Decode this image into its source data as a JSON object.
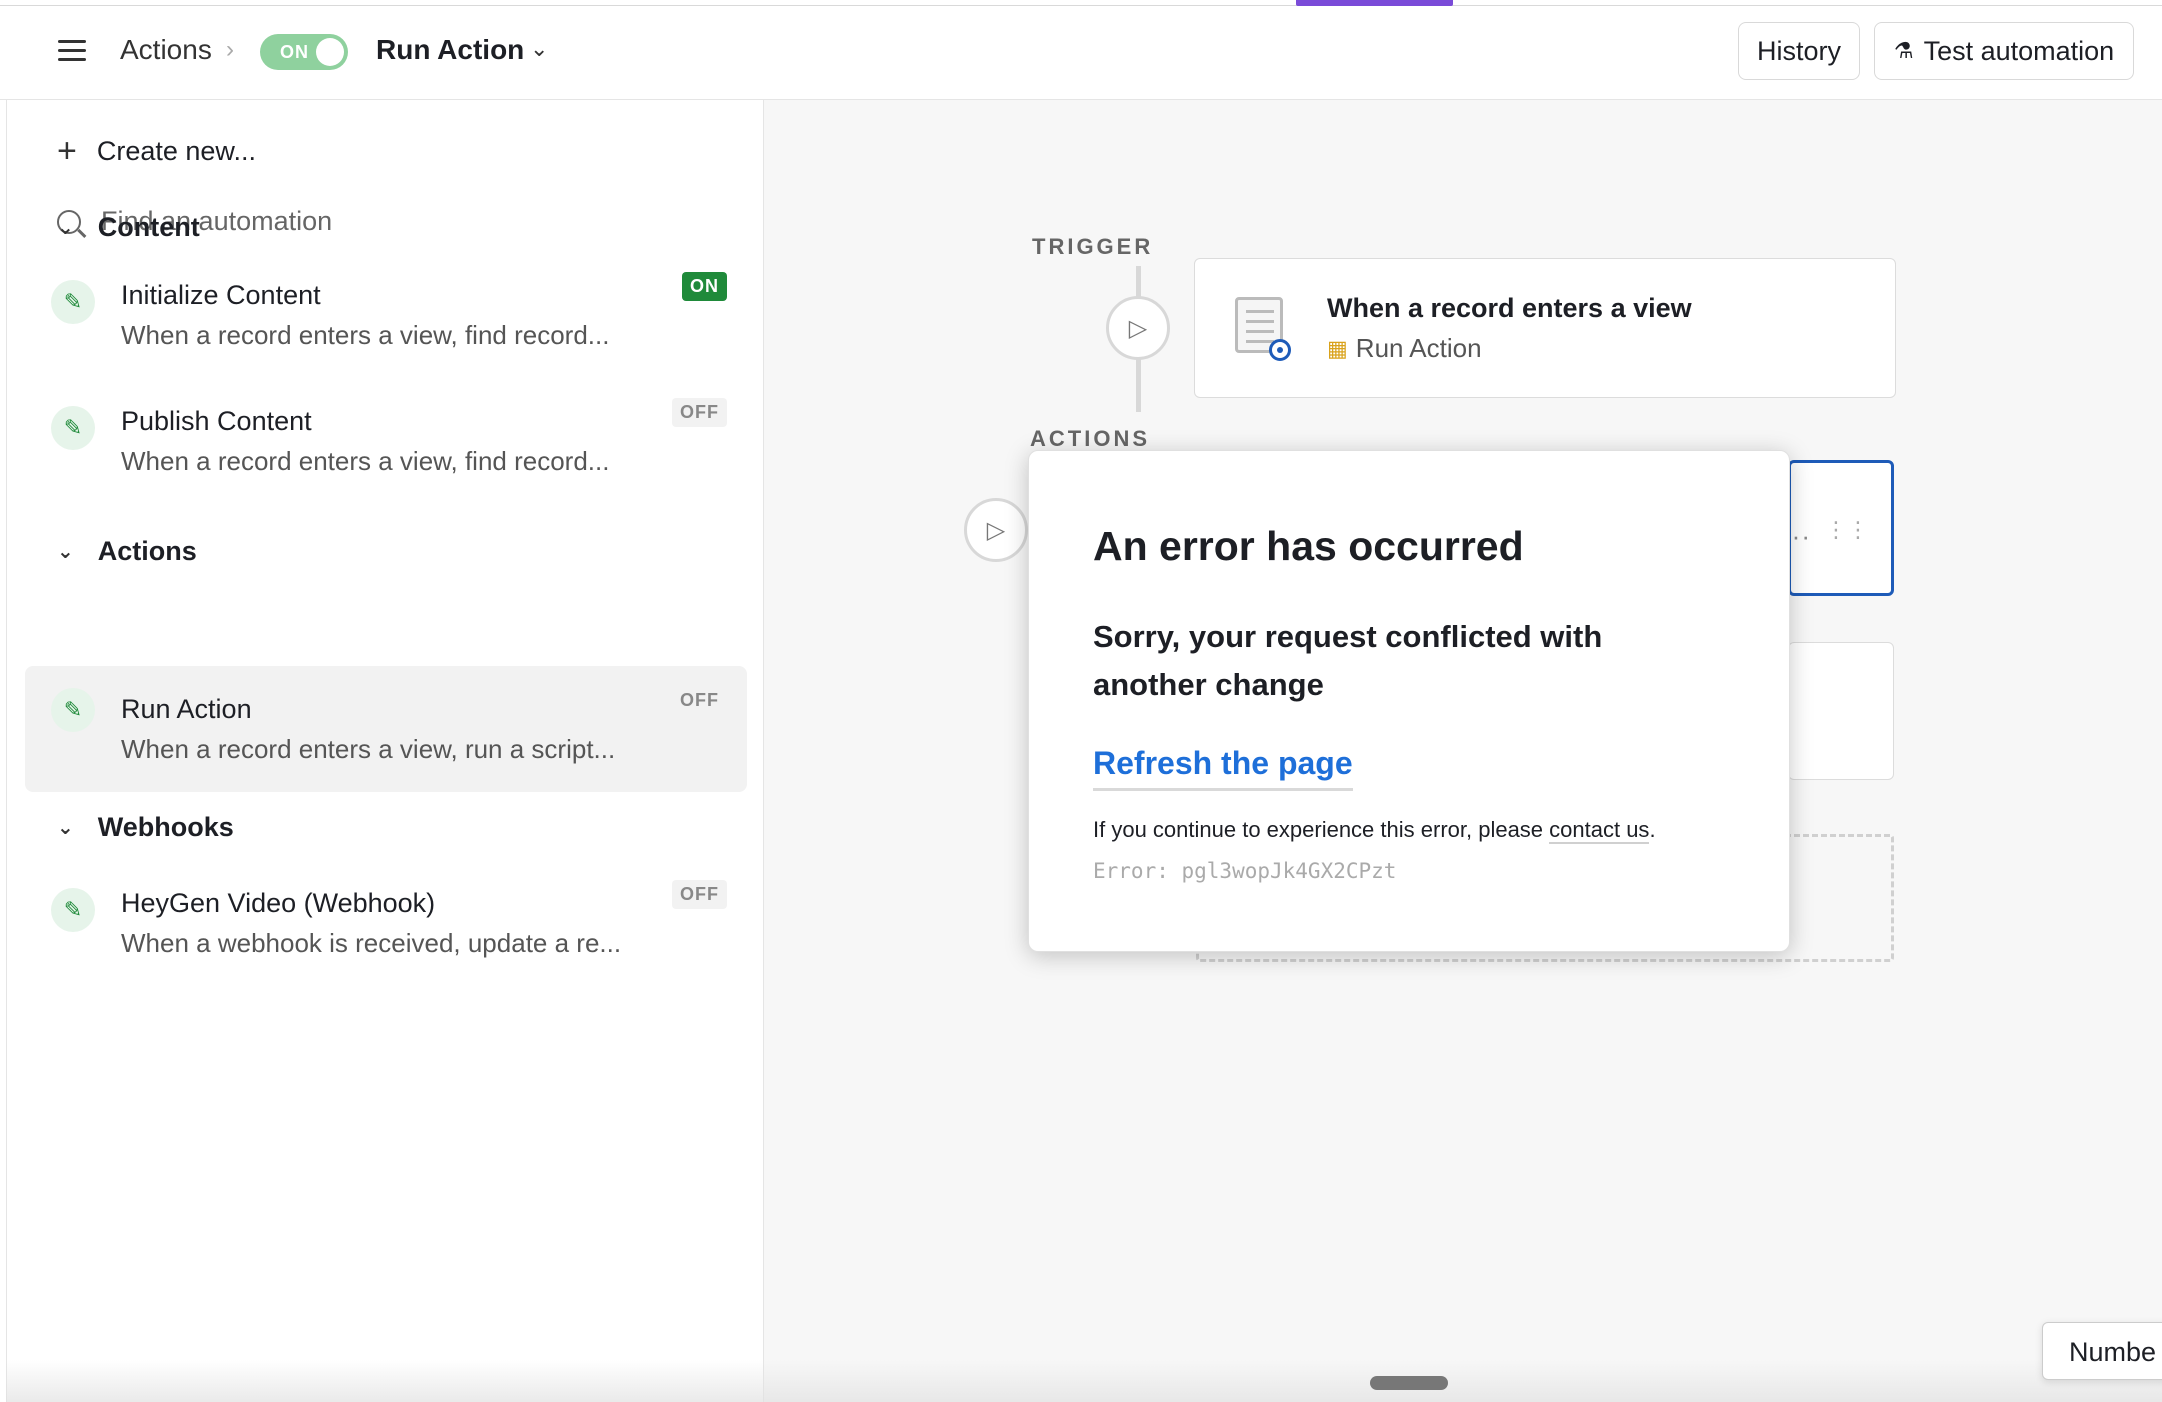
{
  "header": {
    "breadcrumb": "Actions",
    "toggle_label": "ON",
    "title": "Run Action",
    "history_label": "History",
    "test_label": "Test automation"
  },
  "sidebar": {
    "create_label": "Create new...",
    "search_placeholder": "Find an automation",
    "sections": [
      {
        "title": "Content",
        "items": [
          {
            "name": "Initialize Content",
            "desc": "When a record enters a view, find record...",
            "status": "ON"
          },
          {
            "name": "Publish Content",
            "desc": "When a record enters a view, find record...",
            "status": "OFF"
          }
        ]
      },
      {
        "title": "Actions",
        "items": [
          {
            "name": "Run Action",
            "desc": "When a record enters a view, run a script...",
            "status": "OFF"
          }
        ]
      },
      {
        "title": "Webhooks",
        "items": [
          {
            "name": "HeyGen Video (Webhook)",
            "desc": "When a webhook is received, update a re...",
            "status": "OFF"
          }
        ]
      }
    ]
  },
  "canvas": {
    "trigger_label": "TRIGGER",
    "actions_label": "ACTIONS",
    "trigger_card": {
      "title": "When a record enters a view",
      "subtitle": "Run Action"
    }
  },
  "modal": {
    "title": "An error has occurred",
    "message": "Sorry, your request conflicted with another change",
    "refresh_label": "Refresh the page",
    "help_prefix": "If you continue to experience this error, please ",
    "help_link": "contact us",
    "help_suffix": ".",
    "error_code": "Error: pgl3wopJk4GX2CPzt"
  },
  "tooltip": {
    "text": "Numbe"
  },
  "colors": {
    "accent": "#7a4bd8",
    "on_green": "#1f8a3a",
    "link_blue": "#1e6fd9",
    "selected_border": "#1e5bb8"
  }
}
